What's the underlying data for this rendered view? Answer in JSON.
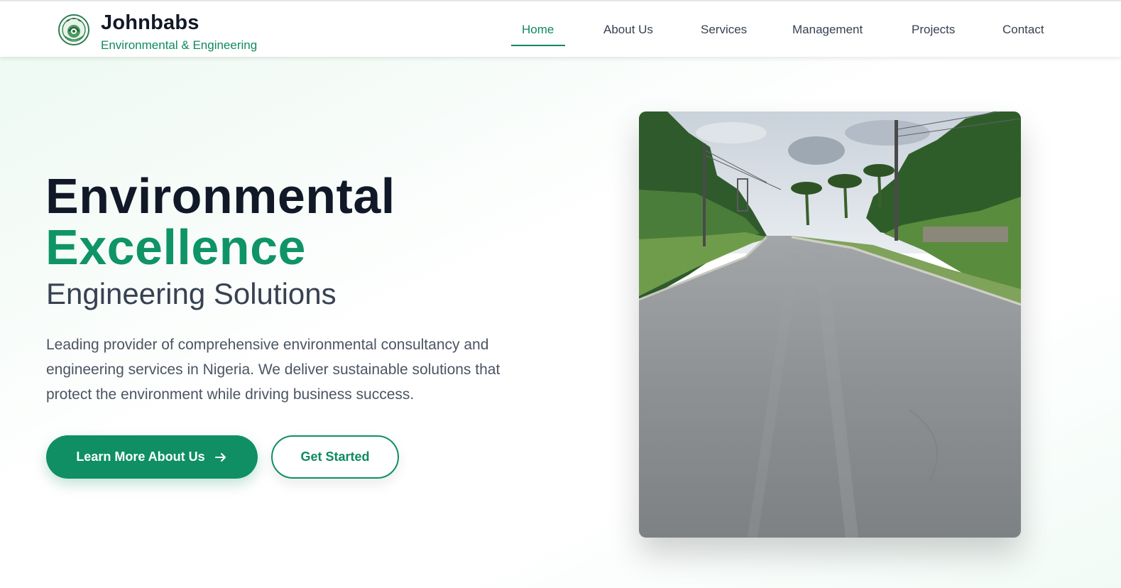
{
  "header": {
    "brand_name": "Johnbabs",
    "brand_tagline": "Environmental & Engineering",
    "logo_icon": "company-seal-logo",
    "nav": [
      {
        "label": "Home",
        "active": true
      },
      {
        "label": "About Us",
        "active": false
      },
      {
        "label": "Services",
        "active": false
      },
      {
        "label": "Management",
        "active": false
      },
      {
        "label": "Projects",
        "active": false
      },
      {
        "label": "Contact",
        "active": false
      }
    ]
  },
  "hero": {
    "title_line1": "Environmental",
    "title_line2": "Excellence",
    "title_line3": "Engineering Solutions",
    "description": "Leading provider of comprehensive environmental consultancy and engineering services in Nigeria. We deliver sustainable solutions that protect the environment while driving business success.",
    "primary_button_label": "Learn More About Us",
    "primary_button_icon": "arrow-right-icon",
    "secondary_button_label": "Get Started",
    "image_subject": "paved-road-photo"
  },
  "colors": {
    "brand_green": "#0f8f63",
    "heading_dark": "#111827",
    "body_text": "#4b5563"
  }
}
